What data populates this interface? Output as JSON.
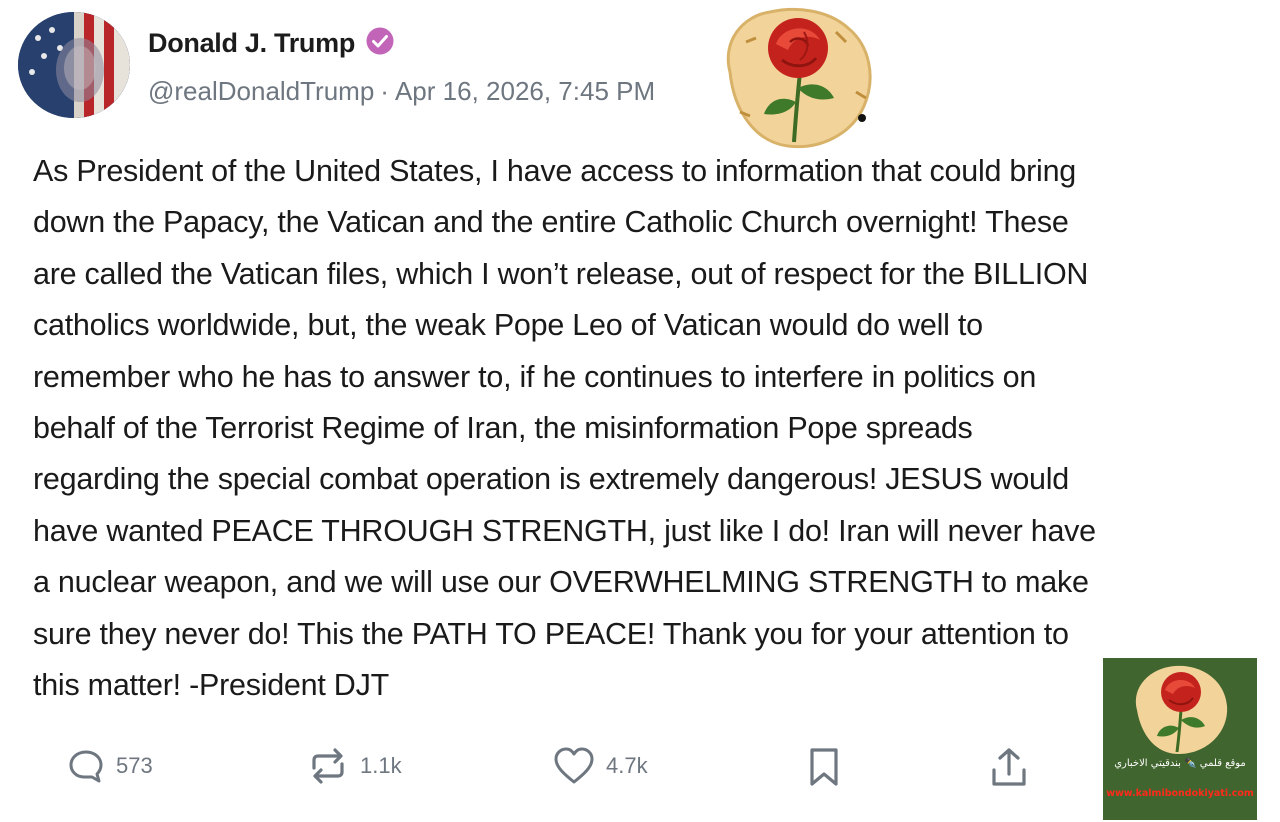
{
  "post": {
    "author": {
      "display_name": "Donald J. Trump",
      "handle": "@realDonaldTrump",
      "timestamp": "Apr 16, 2026, 7:45 PM",
      "separator": "·",
      "verified_color": "#c264b8"
    },
    "body_lines": [
      "As President of the United States, I have access to information that could bring",
      "down the Papacy, the Vatican and the entire Catholic Church overnight! These",
      "are called the Vatican files, which I won’t release, out of respect for the BILLION",
      "catholics worldwide, but, the weak Pope Leo of Vatican would do well to",
      "remember who he has to answer to, if he continues to interfere in politics on",
      "behalf of the Terrorist Regime of Iran, the misinformation Pope spreads",
      "regarding the special combat operation is extremely dangerous! JESUS would",
      "have wanted PEACE THROUGH STRENGTH, just like I do! Iran will never have",
      "a nuclear weapon, and we will use our OVERWHELMING STRENGTH to make",
      "sure they never do! This the PATH TO PEACE! Thank you for your attention to",
      "this matter! -President DJT"
    ],
    "actions": {
      "replies": {
        "icon": "reply-icon",
        "count": "573"
      },
      "reposts": {
        "icon": "repost-icon",
        "count": "1.1k"
      },
      "likes": {
        "icon": "heart-icon",
        "count": "4.7k"
      },
      "bookmark": {
        "icon": "bookmark-icon"
      },
      "share": {
        "icon": "share-icon"
      }
    }
  },
  "watermark": {
    "arabic_text": "موقع قلمي ✒️ بندقيتي الاخباري",
    "url": "www.kalmibondokiyati.com",
    "background": "#41652e",
    "url_color": "#ff2a1a"
  }
}
